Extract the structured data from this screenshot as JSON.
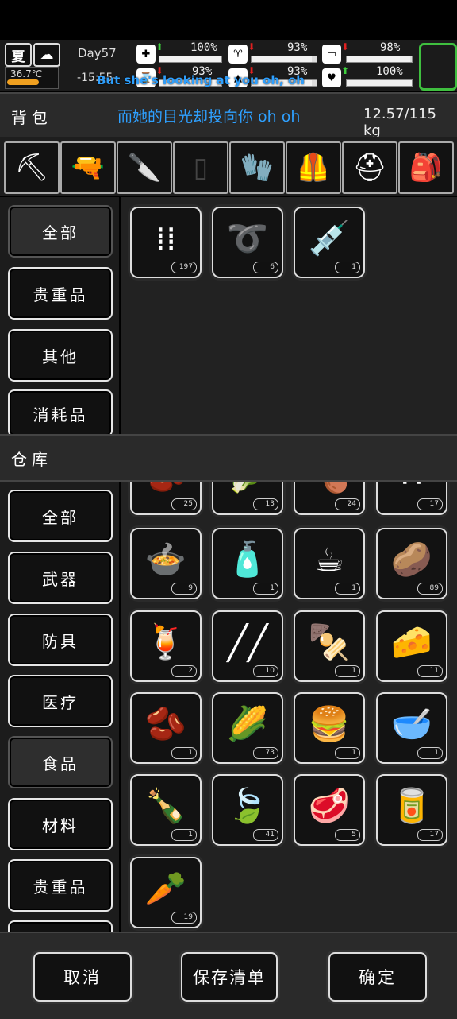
{
  "status": {
    "season": "夏",
    "weather_icon": "cloud-icon",
    "temperature": "36.7℃",
    "day": "Day57",
    "time": "-15:55-",
    "stats": [
      {
        "name": "health",
        "icon": "medkit-icon",
        "value": "100%",
        "level": 1.0,
        "trend": "up"
      },
      {
        "name": "hunger",
        "icon": "stomach-icon",
        "value": "93%",
        "level": 0.93,
        "trend": "down"
      },
      {
        "name": "energy",
        "icon": "battery-icon",
        "value": "98%",
        "level": 0.98,
        "trend": "down"
      },
      {
        "name": "thirst",
        "icon": "hourglass-icon",
        "value": "93%",
        "level": 0.93,
        "trend": "down"
      },
      {
        "name": "water",
        "icon": "water-drop-icon",
        "value": "93%",
        "level": 0.93,
        "trend": "down"
      },
      {
        "name": "mood",
        "icon": "heart-icon",
        "value": "100%",
        "level": 1.0,
        "trend": "up"
      }
    ],
    "lyric_en": "But she's looking at you oh, oh",
    "accent_green": "#3fbf3f"
  },
  "backpack": {
    "title": "背包",
    "lyric_zh": "而她的目光却投向你 oh oh",
    "weight": "12.57/115 kg",
    "equipment": [
      {
        "name": "shovel",
        "icon": "shovel-icon",
        "glyph": "⛏"
      },
      {
        "name": "pistol",
        "icon": "pistol-icon",
        "glyph": "🔫"
      },
      {
        "name": "knife",
        "icon": "knife-icon",
        "glyph": "🔪"
      },
      {
        "name": "empty-armor",
        "icon": "armor-icon",
        "glyph": "▯"
      },
      {
        "name": "gloves",
        "icon": "gloves-icon",
        "glyph": "🧤"
      },
      {
        "name": "vest",
        "icon": "vest-icon",
        "glyph": "🦺"
      },
      {
        "name": "helmet",
        "icon": "helmet-icon",
        "glyph": "⛑"
      },
      {
        "name": "backpack",
        "icon": "backpack-icon",
        "glyph": "🎒"
      }
    ],
    "categories": [
      "全部",
      "贵重品",
      "其他",
      "消耗品"
    ],
    "items": [
      {
        "name": "bullets",
        "icon": "bullets-icon",
        "glyph": "⁞⁞",
        "count": "197"
      },
      {
        "name": "rope",
        "icon": "rope-icon",
        "glyph": "➰",
        "count": "6"
      },
      {
        "name": "syringe-vii",
        "icon": "syringe-icon",
        "glyph": "💉",
        "count": "1"
      }
    ]
  },
  "warehouse": {
    "title": "仓库",
    "categories": [
      "全部",
      "武器",
      "防具",
      "医疗",
      "食品",
      "材料",
      "贵重品"
    ],
    "partial_items": [
      {
        "name": "seeds",
        "icon": "seeds-icon",
        "glyph": "🫘",
        "count": "25"
      },
      {
        "name": "vegetable",
        "icon": "vegetable-icon",
        "glyph": "🥬",
        "count": "13"
      },
      {
        "name": "poultry",
        "icon": "chicken-icon",
        "glyph": "🍗",
        "count": "24"
      },
      {
        "name": "grain",
        "icon": "grain-icon",
        "glyph": "∴",
        "count": "17"
      }
    ],
    "items": [
      {
        "name": "stew-pot",
        "icon": "pot-icon",
        "glyph": "🍲",
        "count": "9"
      },
      {
        "name": "water-bottle",
        "icon": "bottle-icon",
        "glyph": "🧴",
        "count": "1"
      },
      {
        "name": "coffee-cup",
        "icon": "coffee-icon",
        "glyph": "☕",
        "count": "1"
      },
      {
        "name": "potato",
        "icon": "potato-icon",
        "glyph": "🥔",
        "count": "89"
      },
      {
        "name": "juice",
        "icon": "juice-icon",
        "glyph": "🍹",
        "count": "2"
      },
      {
        "name": "skewers",
        "icon": "skewer-icon",
        "glyph": "╱╱",
        "count": "10"
      },
      {
        "name": "kebab",
        "icon": "kebab-icon",
        "glyph": "🍢",
        "count": "1"
      },
      {
        "name": "cheese",
        "icon": "cheese-icon",
        "glyph": "🧀",
        "count": "11"
      },
      {
        "name": "beans",
        "icon": "beans-icon",
        "glyph": "🫘",
        "count": "1"
      },
      {
        "name": "corn",
        "icon": "corn-icon",
        "glyph": "🌽",
        "count": "73"
      },
      {
        "name": "burger",
        "icon": "burger-icon",
        "glyph": "🍔",
        "count": "1"
      },
      {
        "name": "soup-bowl",
        "icon": "soup-icon",
        "glyph": "🥣",
        "count": "1"
      },
      {
        "name": "liquor",
        "icon": "liquor-bottle-icon",
        "glyph": "🍾",
        "count": "1"
      },
      {
        "name": "leaves",
        "icon": "leaf-icon",
        "glyph": "🍃",
        "count": "41"
      },
      {
        "name": "meat",
        "icon": "meat-icon",
        "glyph": "🥩",
        "count": "5"
      },
      {
        "name": "canned-food",
        "icon": "can-icon",
        "glyph": "🥫",
        "count": "17"
      },
      {
        "name": "carrot",
        "icon": "carrot-icon",
        "glyph": "🥕",
        "count": "19"
      }
    ]
  },
  "footer": {
    "cancel": "取消",
    "save_list": "保存清单",
    "confirm": "确定"
  }
}
